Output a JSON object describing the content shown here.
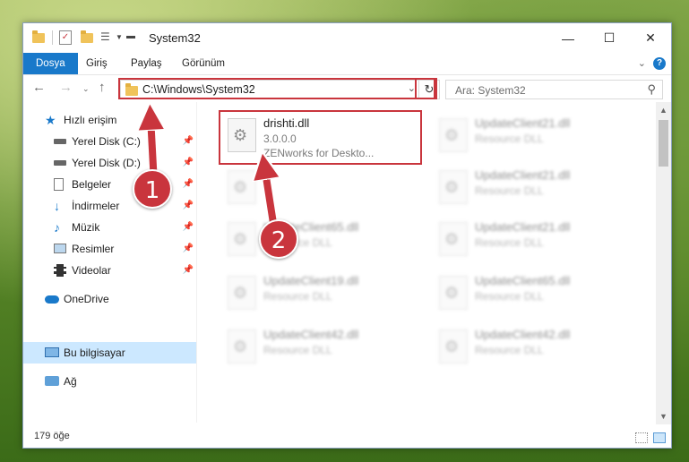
{
  "window": {
    "title": "System32",
    "controls": {
      "minimize": "—",
      "maximize": "☐",
      "close": "✕"
    }
  },
  "ribbon": {
    "tabs": [
      "Dosya",
      "Giriş",
      "Paylaş",
      "Görünüm"
    ],
    "help": "?"
  },
  "navigation": {
    "address": "C:\\Windows\\System32",
    "search_placeholder": "Ara: System32"
  },
  "sidebar": {
    "items": [
      {
        "label": "Hızlı erişim",
        "icon": "star-icon",
        "pinned": false
      },
      {
        "label": "Yerel Disk (C:)",
        "icon": "drive-icon",
        "pinned": true
      },
      {
        "label": "Yerel Disk (D:)",
        "icon": "drive-icon",
        "pinned": true
      },
      {
        "label": "Belgeler",
        "icon": "documents-icon",
        "pinned": true
      },
      {
        "label": "İndirmeler",
        "icon": "download-icon",
        "pinned": true
      },
      {
        "label": "Müzik",
        "icon": "music-icon",
        "pinned": true
      },
      {
        "label": "Resimler",
        "icon": "pictures-icon",
        "pinned": true
      },
      {
        "label": "Videolar",
        "icon": "videos-icon",
        "pinned": true
      },
      {
        "label": "OneDrive",
        "icon": "cloud-icon",
        "pinned": false
      },
      {
        "label": "Bu bilgisayar",
        "icon": "computer-icon",
        "pinned": false,
        "selected": true
      },
      {
        "label": "Ağ",
        "icon": "network-icon",
        "pinned": false
      }
    ]
  },
  "files": {
    "highlighted": {
      "name": "drishti.dll",
      "version": "3.0.0.0",
      "description": "ZENworks for Deskto..."
    },
    "blurred": [
      {
        "name": "UpdateClient21.dll",
        "type": "Resource DLL"
      },
      {
        "name": "UpdateClient21.dll",
        "type": "Resource DLL"
      },
      {
        "name": "UpdateClient21.dll",
        "type": "Resource DLL"
      },
      {
        "name": "UpdateClient65.dll",
        "type": "Resource DLL"
      },
      {
        "name": "UpdateClient21.dll",
        "type": "Resource DLL"
      },
      {
        "name": "UpdateClient19.dll",
        "type": "Resource DLL"
      },
      {
        "name": "UpdateClient65.dll",
        "type": "Resource DLL"
      },
      {
        "name": "UpdateClient42.dll",
        "type": "Resource DLL"
      },
      {
        "name": "UpdateClient42.dll",
        "type": "Resource DLL"
      }
    ]
  },
  "status": {
    "item_count": "179 öğe"
  },
  "annotations": {
    "step1": "1",
    "step2": "2",
    "color": "#c9353d"
  }
}
